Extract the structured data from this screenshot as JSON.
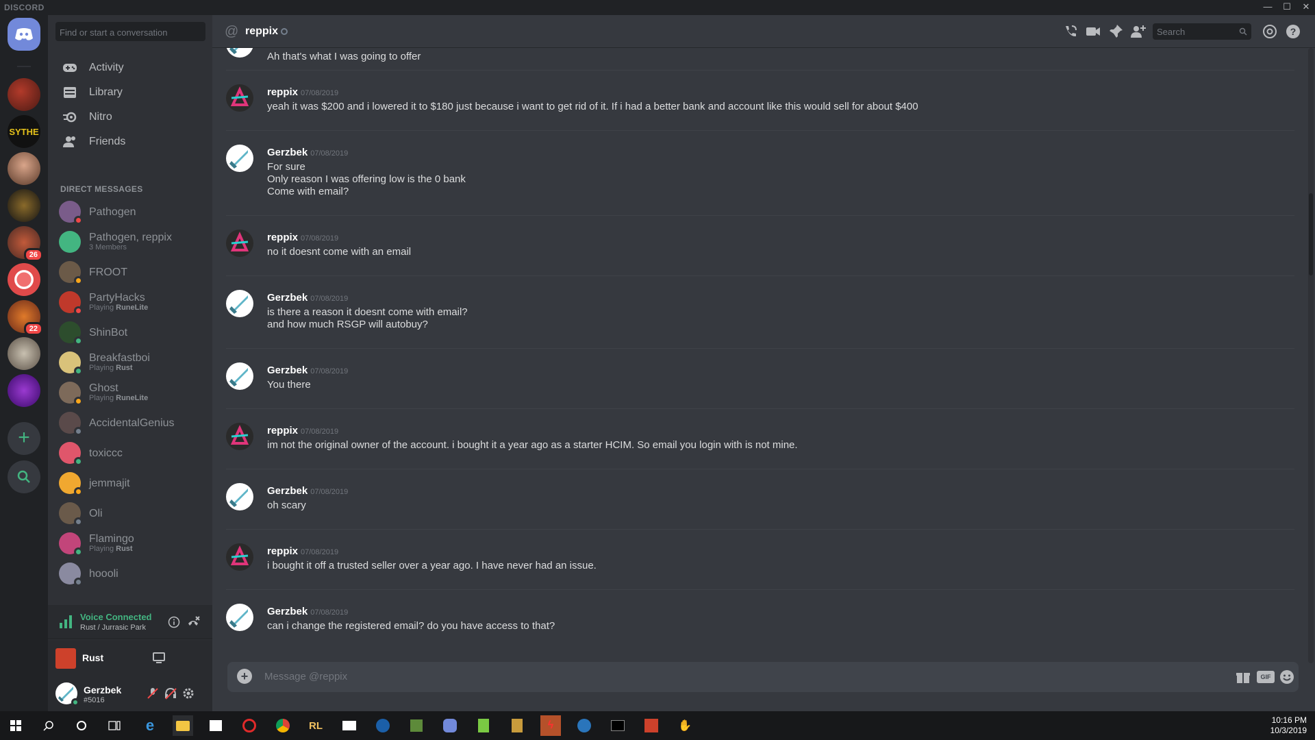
{
  "window": {
    "brand": "DISCORD"
  },
  "guilds": [
    {
      "name": "home",
      "badge": ""
    },
    {
      "name": "server-1",
      "badge": ""
    },
    {
      "name": "sythe",
      "label": "SYTHE",
      "badge": ""
    },
    {
      "name": "server-3",
      "badge": ""
    },
    {
      "name": "server-4",
      "badge": ""
    },
    {
      "name": "server-5",
      "badge": "26"
    },
    {
      "name": "server-6",
      "badge": ""
    },
    {
      "name": "server-7",
      "badge": "22"
    },
    {
      "name": "server-8",
      "badge": ""
    },
    {
      "name": "server-9",
      "badge": ""
    }
  ],
  "sidebar": {
    "search_placeholder": "Find or start a conversation",
    "nav": [
      {
        "label": "Activity"
      },
      {
        "label": "Library"
      },
      {
        "label": "Nitro"
      },
      {
        "label": "Friends"
      }
    ],
    "dm_header": "DIRECT MESSAGES",
    "dms": [
      {
        "name": "Pathogen",
        "sub": "",
        "sub_game": "",
        "status": "#f04747",
        "color": "#7a5c8a"
      },
      {
        "name": "Pathogen, reppix",
        "sub": "3 Members",
        "sub_game": "",
        "status": "",
        "color": "#43b581"
      },
      {
        "name": "FROOT",
        "sub": "",
        "sub_game": "",
        "status": "#faa61a",
        "color": "#6b5a48"
      },
      {
        "name": "PartyHacks",
        "sub": "Playing ",
        "sub_game": "RuneLite",
        "status": "#f04747",
        "color": "#c0392b"
      },
      {
        "name": "ShinBot",
        "sub": "",
        "sub_game": "",
        "status": "#43b581",
        "color": "#2d4d2d"
      },
      {
        "name": "Breakfastboi",
        "sub": "Playing ",
        "sub_game": "Rust",
        "status": "#43b581",
        "color": "#d9c27a"
      },
      {
        "name": "Ghost",
        "sub": "Playing ",
        "sub_game": "RuneLite",
        "status": "#faa61a",
        "color": "#7d6a5a"
      },
      {
        "name": "AccidentalGenius",
        "sub": "",
        "sub_game": "",
        "status": "#747f8d",
        "color": "#5a4a4a"
      },
      {
        "name": "toxiccc",
        "sub": "",
        "sub_game": "",
        "status": "#43b581",
        "color": "#e0566b"
      },
      {
        "name": "jemmajit",
        "sub": "",
        "sub_game": "",
        "status": "#faa61a",
        "color": "#f0a830"
      },
      {
        "name": "Oli",
        "sub": "",
        "sub_game": "",
        "status": "#747f8d",
        "color": "#6a5a4a"
      },
      {
        "name": "Flamingo",
        "sub": "Playing ",
        "sub_game": "Rust",
        "status": "#43b581",
        "color": "#c2457a"
      },
      {
        "name": "hoooli",
        "sub": "",
        "sub_game": "",
        "status": "#747f8d",
        "color": "#8a8aa0"
      }
    ]
  },
  "voice": {
    "status": "Voice Connected",
    "channel": "Rust / Jurrasic Park"
  },
  "game": {
    "name": "Rust"
  },
  "user": {
    "name": "Gerzbek",
    "tag": "#5016"
  },
  "channel": {
    "title": "reppix",
    "search_placeholder": "Search"
  },
  "messages": [
    {
      "author": "",
      "time": "",
      "avatar": "gerzbek",
      "lines": [
        "Ah that's what I was going to offer"
      ]
    },
    {
      "author": "reppix",
      "time": "07/08/2019",
      "avatar": "reppix",
      "lines": [
        "yeah it was $200 and i lowered it to $180 just because i want to get rid of it. If i had a better bank and account like this would sell for about $400"
      ]
    },
    {
      "author": "Gerzbek",
      "time": "07/08/2019",
      "avatar": "gerzbek",
      "lines": [
        "For sure",
        "Only reason I was offering low is the 0 bank",
        "Come with email?"
      ]
    },
    {
      "author": "reppix",
      "time": "07/08/2019",
      "avatar": "reppix",
      "lines": [
        "no it doesnt come with an email"
      ]
    },
    {
      "author": "Gerzbek",
      "time": "07/08/2019",
      "avatar": "gerzbek",
      "lines": [
        "is there a reason it doesnt come with email?",
        "and how much RSGP will autobuy?"
      ]
    },
    {
      "author": "Gerzbek",
      "time": "07/08/2019",
      "avatar": "gerzbek",
      "lines": [
        "You there"
      ]
    },
    {
      "author": "reppix",
      "time": "07/08/2019",
      "avatar": "reppix",
      "lines": [
        "im not the original owner of the account. i bought it a year ago as a starter HCIM. So email you login with is not mine."
      ]
    },
    {
      "author": "Gerzbek",
      "time": "07/08/2019",
      "avatar": "gerzbek",
      "lines": [
        "oh scary"
      ]
    },
    {
      "author": "reppix",
      "time": "07/08/2019",
      "avatar": "reppix",
      "lines": [
        "i bought it off a trusted seller over a year ago. I have never had an issue."
      ]
    },
    {
      "author": "Gerzbek",
      "time": "07/08/2019",
      "avatar": "gerzbek",
      "lines": [
        "can i change the registered email? do you have access to that?"
      ]
    }
  ],
  "composer": {
    "placeholder": "Message @reppix",
    "gif_label": "GIF"
  },
  "taskbar": {
    "time": "10:16 PM",
    "date": "10/3/2019"
  }
}
